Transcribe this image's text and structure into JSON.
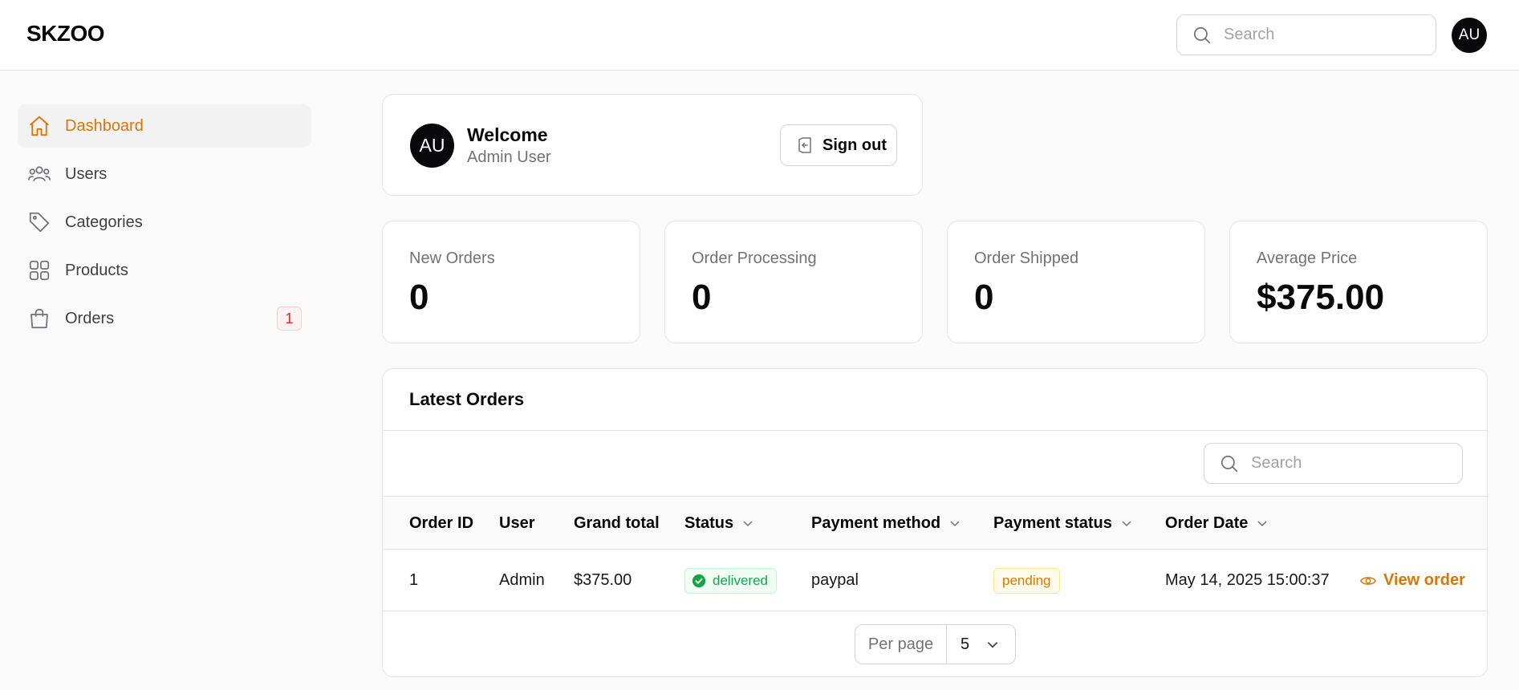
{
  "app": {
    "brand": "SKZOO"
  },
  "header": {
    "search_placeholder": "Search",
    "avatar_initials": "AU"
  },
  "sidebar": {
    "items": [
      {
        "label": "Dashboard",
        "icon": "home-icon",
        "active": true
      },
      {
        "label": "Users",
        "icon": "users-icon"
      },
      {
        "label": "Categories",
        "icon": "tag-icon"
      },
      {
        "label": "Products",
        "icon": "grid-icon"
      },
      {
        "label": "Orders",
        "icon": "shopping-bag-icon",
        "badge": "1"
      }
    ]
  },
  "welcome": {
    "avatar_initials": "AU",
    "title": "Welcome",
    "subtitle": "Admin User",
    "sign_out_label": "Sign out"
  },
  "stats": [
    {
      "label": "New Orders",
      "value": "0"
    },
    {
      "label": "Order Processing",
      "value": "0"
    },
    {
      "label": "Order Shipped",
      "value": "0"
    },
    {
      "label": "Average Price",
      "value": "$375.00"
    }
  ],
  "latest_orders": {
    "title": "Latest Orders",
    "search_placeholder": "Search",
    "columns": [
      "Order ID",
      "User",
      "Grand total",
      "Status",
      "Payment method",
      "Payment status",
      "Order Date"
    ],
    "rows": [
      {
        "order_id": "1",
        "user": "Admin",
        "grand_total": "$375.00",
        "status": "delivered",
        "payment_method": "paypal",
        "payment_status": "pending",
        "order_date": "May 14, 2025 15:00:37",
        "action": "View order"
      }
    ],
    "per_page_label": "Per page",
    "per_page_value": "5"
  },
  "colors": {
    "accent": "#d97706",
    "success": "#16a34a",
    "danger": "#dc2626",
    "dark": "#09090b"
  }
}
